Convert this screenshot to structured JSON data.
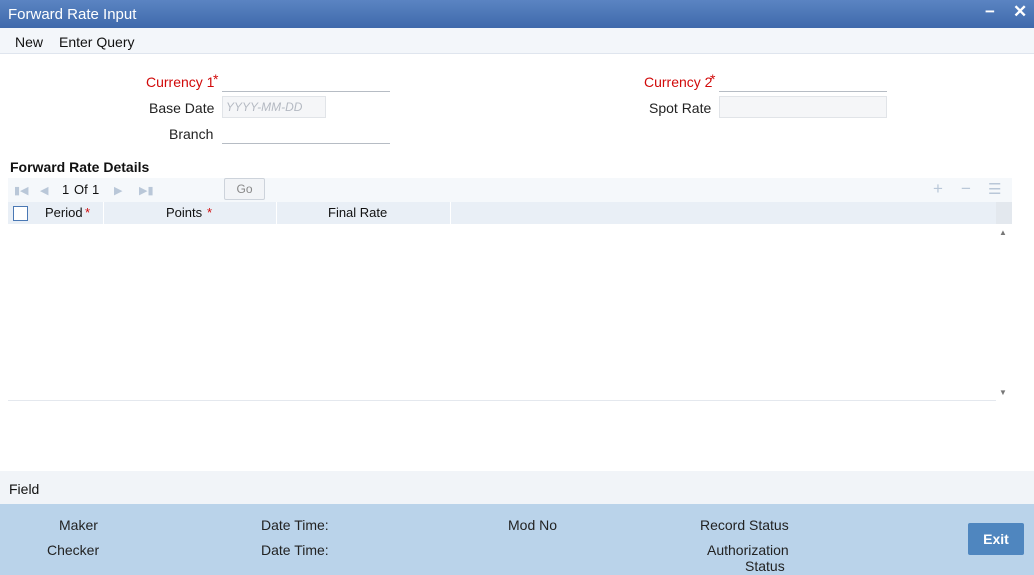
{
  "window": {
    "title": "Forward Rate Input",
    "minimize_glyph": "−",
    "close_glyph": "✕"
  },
  "menu": {
    "items": [
      "New",
      "Enter Query"
    ]
  },
  "form": {
    "currency1_label": "Currency 1",
    "currency2_label": "Currency 2",
    "base_date_label": "Base Date",
    "base_date_placeholder": "YYYY-MM-DD",
    "spot_rate_label": "Spot Rate",
    "branch_label": "Branch",
    "required_marker": "*"
  },
  "grid": {
    "section_title": "Forward Rate Details",
    "pager": {
      "current": "1",
      "of_label": "Of",
      "total": "1"
    },
    "go_label": "Go",
    "columns": [
      {
        "label": "Period",
        "required": "*"
      },
      {
        "label": "Points",
        "required": "*"
      },
      {
        "label": "Final Rate",
        "required": ""
      }
    ],
    "rows": []
  },
  "fieldbar": {
    "label": "Field"
  },
  "footer": {
    "maker_label": "Maker",
    "checker_label": "Checker",
    "date_time_label": "Date Time:",
    "mod_no_label": "Mod No",
    "record_status_label": "Record Status",
    "auth_status_line1": "Authorization",
    "auth_status_line2": "Status",
    "exit_label": "Exit"
  },
  "colors": {
    "title_bar": "#4a74b5",
    "required": "#d10a0a",
    "footer_bg": "#bad3ea",
    "exit_button": "#4f86bf"
  }
}
